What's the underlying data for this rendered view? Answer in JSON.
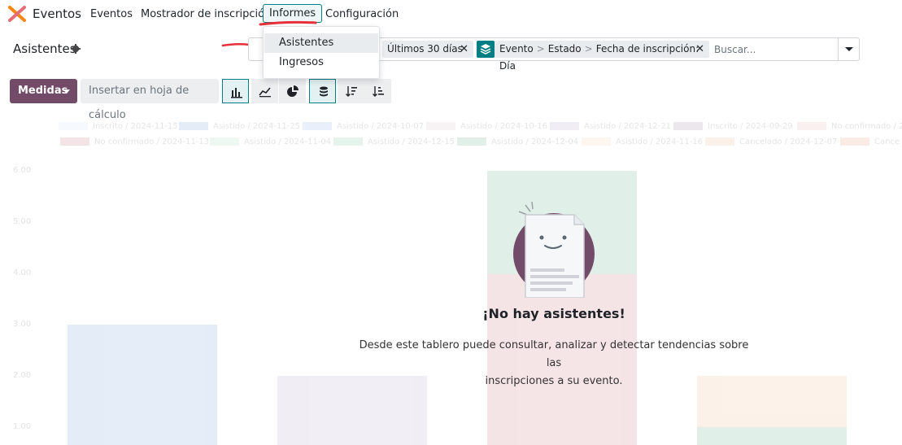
{
  "navbar": {
    "app_name": "Eventos",
    "menus": [
      "Eventos",
      "Mostrador de inscripción",
      "Informes",
      "Configuración"
    ],
    "active_menu": "Informes",
    "brand_color": "#714b67"
  },
  "dropdown": {
    "items": [
      "Asistentes",
      "Ingresos"
    ],
    "highlighted": "Asistentes"
  },
  "control_panel": {
    "title": "Asistentes",
    "title_icon": "gear-icon",
    "search": {
      "facets": [
        {
          "text": "Últimos 30 días",
          "icon": null
        },
        {
          "text": "Evento",
          "icon": "layers-icon",
          "groups": [
            "Evento",
            "Estado",
            "Fecha de inscripción: Día"
          ]
        }
      ],
      "placeholder": "Buscar..."
    }
  },
  "toolbar": {
    "measures_label": "Medidas",
    "sheet_label": "Insertar en hoja de cálculo",
    "chart_buttons": [
      "bar-chart-icon",
      "line-chart-icon",
      "pie-chart-icon"
    ],
    "option_buttons": [
      "stack-icon",
      "sort-desc-icon",
      "sort-asc-icon"
    ],
    "active_chart": "bar-chart-icon",
    "accent": "#017e84"
  },
  "empty_state": {
    "title": "¡No hay asistentes!",
    "line1": "Desde este tablero puede consultar, analizar y detectar tendencias sobre las",
    "line2": "inscripciones a su evento."
  },
  "chart_data": {
    "type": "bar",
    "categories": [
      "",
      "",
      "",
      ""
    ],
    "series": [
      {
        "name": "Inscrito / 2024-11-15",
        "values": [
          3,
          0,
          0,
          0
        ]
      },
      {
        "name": "Asistido / 2024-11-25",
        "values": [
          0,
          0,
          0,
          0
        ]
      },
      {
        "name": "Asistido / 2024-10-07",
        "values": [
          0,
          0,
          0,
          0
        ]
      },
      {
        "name": "Asistido / 2024-10-16",
        "values": [
          0,
          0,
          0,
          0
        ]
      },
      {
        "name": "Asistido / 2024-12-21",
        "values": [
          0,
          2,
          0,
          0
        ]
      },
      {
        "name": "Inscrito / 2024-09-29",
        "values": [
          0,
          0,
          0,
          0
        ]
      },
      {
        "name": "No confirmado / 2024-11-13",
        "values": [
          0,
          0,
          3,
          0
        ]
      },
      {
        "name": "Asistido / 2024-11-04",
        "values": [
          0,
          0,
          3,
          1
        ]
      },
      {
        "name": "Asistido / 2024-12-15",
        "values": [
          0,
          0,
          0,
          0
        ]
      },
      {
        "name": "Asistido / 2024-12-04",
        "values": [
          0,
          0,
          0,
          0
        ]
      },
      {
        "name": "Asistido / 2024-11-16",
        "values": [
          0,
          0,
          0,
          1
        ]
      },
      {
        "name": "Cancelado / 2024-12-07",
        "values": [
          0,
          0,
          0,
          0
        ]
      }
    ],
    "yticks": [
      "6.00",
      "5.00",
      "4.00",
      "3.00",
      "2.00",
      "1.00"
    ],
    "ylim": [
      0,
      6
    ]
  }
}
